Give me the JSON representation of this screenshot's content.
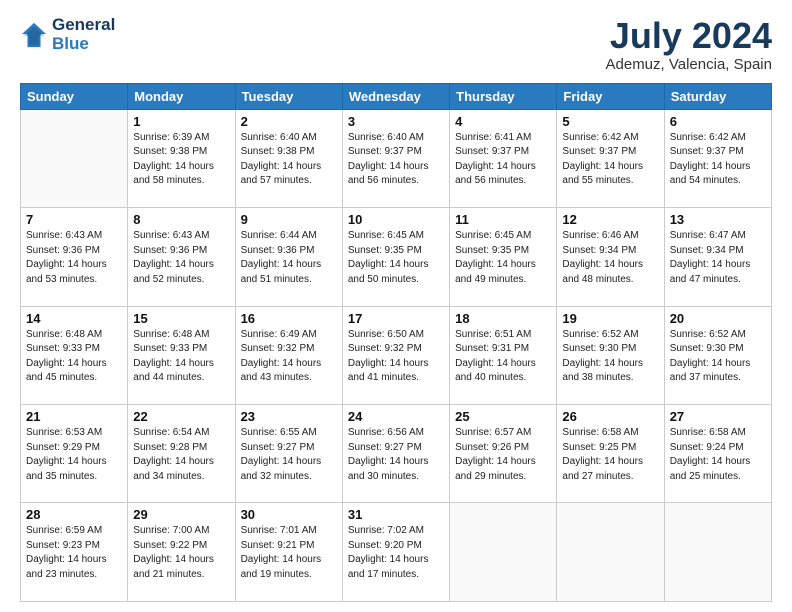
{
  "header": {
    "logo_line1": "General",
    "logo_line2": "Blue",
    "title": "July 2024",
    "subtitle": "Ademuz, Valencia, Spain"
  },
  "days_of_week": [
    "Sunday",
    "Monday",
    "Tuesday",
    "Wednesday",
    "Thursday",
    "Friday",
    "Saturday"
  ],
  "weeks": [
    [
      {
        "day": "",
        "sunrise": "",
        "sunset": "",
        "daylight": ""
      },
      {
        "day": "1",
        "sunrise": "Sunrise: 6:39 AM",
        "sunset": "Sunset: 9:38 PM",
        "daylight": "Daylight: 14 hours and 58 minutes."
      },
      {
        "day": "2",
        "sunrise": "Sunrise: 6:40 AM",
        "sunset": "Sunset: 9:38 PM",
        "daylight": "Daylight: 14 hours and 57 minutes."
      },
      {
        "day": "3",
        "sunrise": "Sunrise: 6:40 AM",
        "sunset": "Sunset: 9:37 PM",
        "daylight": "Daylight: 14 hours and 56 minutes."
      },
      {
        "day": "4",
        "sunrise": "Sunrise: 6:41 AM",
        "sunset": "Sunset: 9:37 PM",
        "daylight": "Daylight: 14 hours and 56 minutes."
      },
      {
        "day": "5",
        "sunrise": "Sunrise: 6:42 AM",
        "sunset": "Sunset: 9:37 PM",
        "daylight": "Daylight: 14 hours and 55 minutes."
      },
      {
        "day": "6",
        "sunrise": "Sunrise: 6:42 AM",
        "sunset": "Sunset: 9:37 PM",
        "daylight": "Daylight: 14 hours and 54 minutes."
      }
    ],
    [
      {
        "day": "7",
        "sunrise": "Sunrise: 6:43 AM",
        "sunset": "Sunset: 9:36 PM",
        "daylight": "Daylight: 14 hours and 53 minutes."
      },
      {
        "day": "8",
        "sunrise": "Sunrise: 6:43 AM",
        "sunset": "Sunset: 9:36 PM",
        "daylight": "Daylight: 14 hours and 52 minutes."
      },
      {
        "day": "9",
        "sunrise": "Sunrise: 6:44 AM",
        "sunset": "Sunset: 9:36 PM",
        "daylight": "Daylight: 14 hours and 51 minutes."
      },
      {
        "day": "10",
        "sunrise": "Sunrise: 6:45 AM",
        "sunset": "Sunset: 9:35 PM",
        "daylight": "Daylight: 14 hours and 50 minutes."
      },
      {
        "day": "11",
        "sunrise": "Sunrise: 6:45 AM",
        "sunset": "Sunset: 9:35 PM",
        "daylight": "Daylight: 14 hours and 49 minutes."
      },
      {
        "day": "12",
        "sunrise": "Sunrise: 6:46 AM",
        "sunset": "Sunset: 9:34 PM",
        "daylight": "Daylight: 14 hours and 48 minutes."
      },
      {
        "day": "13",
        "sunrise": "Sunrise: 6:47 AM",
        "sunset": "Sunset: 9:34 PM",
        "daylight": "Daylight: 14 hours and 47 minutes."
      }
    ],
    [
      {
        "day": "14",
        "sunrise": "Sunrise: 6:48 AM",
        "sunset": "Sunset: 9:33 PM",
        "daylight": "Daylight: 14 hours and 45 minutes."
      },
      {
        "day": "15",
        "sunrise": "Sunrise: 6:48 AM",
        "sunset": "Sunset: 9:33 PM",
        "daylight": "Daylight: 14 hours and 44 minutes."
      },
      {
        "day": "16",
        "sunrise": "Sunrise: 6:49 AM",
        "sunset": "Sunset: 9:32 PM",
        "daylight": "Daylight: 14 hours and 43 minutes."
      },
      {
        "day": "17",
        "sunrise": "Sunrise: 6:50 AM",
        "sunset": "Sunset: 9:32 PM",
        "daylight": "Daylight: 14 hours and 41 minutes."
      },
      {
        "day": "18",
        "sunrise": "Sunrise: 6:51 AM",
        "sunset": "Sunset: 9:31 PM",
        "daylight": "Daylight: 14 hours and 40 minutes."
      },
      {
        "day": "19",
        "sunrise": "Sunrise: 6:52 AM",
        "sunset": "Sunset: 9:30 PM",
        "daylight": "Daylight: 14 hours and 38 minutes."
      },
      {
        "day": "20",
        "sunrise": "Sunrise: 6:52 AM",
        "sunset": "Sunset: 9:30 PM",
        "daylight": "Daylight: 14 hours and 37 minutes."
      }
    ],
    [
      {
        "day": "21",
        "sunrise": "Sunrise: 6:53 AM",
        "sunset": "Sunset: 9:29 PM",
        "daylight": "Daylight: 14 hours and 35 minutes."
      },
      {
        "day": "22",
        "sunrise": "Sunrise: 6:54 AM",
        "sunset": "Sunset: 9:28 PM",
        "daylight": "Daylight: 14 hours and 34 minutes."
      },
      {
        "day": "23",
        "sunrise": "Sunrise: 6:55 AM",
        "sunset": "Sunset: 9:27 PM",
        "daylight": "Daylight: 14 hours and 32 minutes."
      },
      {
        "day": "24",
        "sunrise": "Sunrise: 6:56 AM",
        "sunset": "Sunset: 9:27 PM",
        "daylight": "Daylight: 14 hours and 30 minutes."
      },
      {
        "day": "25",
        "sunrise": "Sunrise: 6:57 AM",
        "sunset": "Sunset: 9:26 PM",
        "daylight": "Daylight: 14 hours and 29 minutes."
      },
      {
        "day": "26",
        "sunrise": "Sunrise: 6:58 AM",
        "sunset": "Sunset: 9:25 PM",
        "daylight": "Daylight: 14 hours and 27 minutes."
      },
      {
        "day": "27",
        "sunrise": "Sunrise: 6:58 AM",
        "sunset": "Sunset: 9:24 PM",
        "daylight": "Daylight: 14 hours and 25 minutes."
      }
    ],
    [
      {
        "day": "28",
        "sunrise": "Sunrise: 6:59 AM",
        "sunset": "Sunset: 9:23 PM",
        "daylight": "Daylight: 14 hours and 23 minutes."
      },
      {
        "day": "29",
        "sunrise": "Sunrise: 7:00 AM",
        "sunset": "Sunset: 9:22 PM",
        "daylight": "Daylight: 14 hours and 21 minutes."
      },
      {
        "day": "30",
        "sunrise": "Sunrise: 7:01 AM",
        "sunset": "Sunset: 9:21 PM",
        "daylight": "Daylight: 14 hours and 19 minutes."
      },
      {
        "day": "31",
        "sunrise": "Sunrise: 7:02 AM",
        "sunset": "Sunset: 9:20 PM",
        "daylight": "Daylight: 14 hours and 17 minutes."
      },
      {
        "day": "",
        "sunrise": "",
        "sunset": "",
        "daylight": ""
      },
      {
        "day": "",
        "sunrise": "",
        "sunset": "",
        "daylight": ""
      },
      {
        "day": "",
        "sunrise": "",
        "sunset": "",
        "daylight": ""
      }
    ]
  ]
}
